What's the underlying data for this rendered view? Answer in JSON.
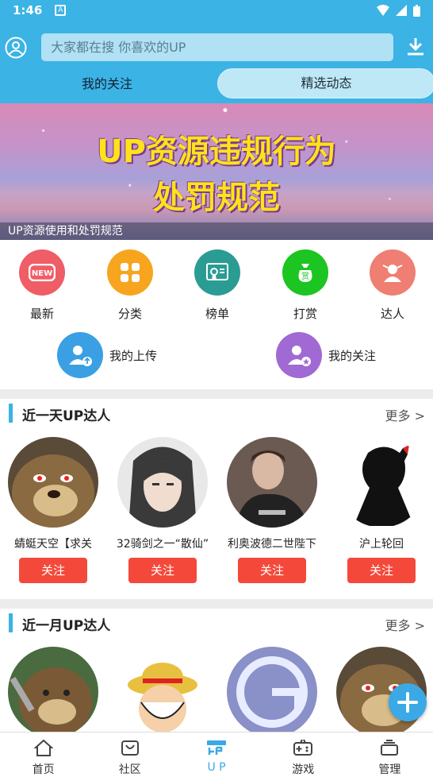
{
  "status_bar": {
    "time": "1:46"
  },
  "header": {
    "search_placeholder": "大家都在搜  你喜欢的UP",
    "tabs": [
      {
        "label": "我的关注",
        "selected": false
      },
      {
        "label": "精选动态",
        "selected": true
      }
    ],
    "accent_color": "#3bb3e5"
  },
  "banner": {
    "title_line1": "UP资源违规行为",
    "title_line2": "处罚规范",
    "caption": "UP资源使用和处罚规范"
  },
  "quick_links": [
    {
      "label": "最新",
      "icon": "new-badge-icon",
      "color": "#ef5d66"
    },
    {
      "label": "分类",
      "icon": "grid-icon",
      "color": "#f7a51f"
    },
    {
      "label": "榜单",
      "icon": "certificate-icon",
      "color": "#2a9c93"
    },
    {
      "label": "打赏",
      "icon": "money-bag-icon",
      "color": "#1cc521"
    },
    {
      "label": "达人",
      "icon": "expert-icon",
      "color": "#ef7e73"
    }
  ],
  "wide_links": [
    {
      "label": "我的上传",
      "icon": "user-upload-icon",
      "color": "#3aa0e3"
    },
    {
      "label": "我的关注",
      "icon": "user-star-icon",
      "color": "#a069d4"
    }
  ],
  "sections": [
    {
      "title": "近一天UP达人",
      "more": "更多 >",
      "users": [
        {
          "name": "蜻蜓天空【求关",
          "follow": "关注"
        },
        {
          "name": "32骑剑之一“散仙”",
          "follow": "关注"
        },
        {
          "name": "利奥波德二世陛下",
          "follow": "关注"
        },
        {
          "name": "沪上轮回",
          "follow": "关注"
        }
      ]
    },
    {
      "title": "近一月UP达人",
      "more": "更多 >",
      "users": [
        {
          "name": "",
          "follow": ""
        },
        {
          "name": "",
          "follow": ""
        },
        {
          "name": "",
          "follow": ""
        },
        {
          "name": "",
          "follow": ""
        }
      ]
    }
  ],
  "bottom_nav": [
    {
      "label": "首页",
      "icon": "home-icon",
      "active": false
    },
    {
      "label": "社区",
      "icon": "community-icon",
      "active": false
    },
    {
      "label": "U P",
      "icon": "up-icon",
      "active": true
    },
    {
      "label": "游戏",
      "icon": "gamepad-icon",
      "active": false
    },
    {
      "label": "管理",
      "icon": "manage-icon",
      "active": false
    }
  ]
}
